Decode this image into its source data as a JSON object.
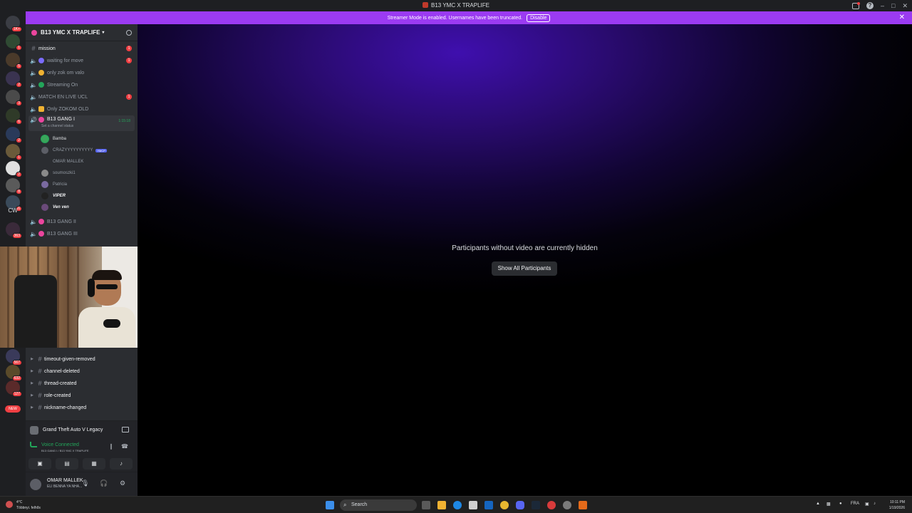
{
  "window": {
    "title": "B13 YMC X TRAPLIFE"
  },
  "banner": {
    "text": "Streamer Mode is enabled. Usernames have been truncated.",
    "disable_label": "Disable"
  },
  "server_rail": {
    "badges": [
      "1K+",
      "1",
      "5",
      "2",
      "3",
      "6",
      "2",
      "1",
      "2",
      "8",
      "6",
      "2",
      "2",
      "363",
      "567",
      "632",
      "127"
    ],
    "cw_label": "CW",
    "new_label": "NEW"
  },
  "guild": {
    "name": "B13 YMC X TRAPLIFE"
  },
  "channels": [
    {
      "name": "mission",
      "type": "text",
      "badge": "1"
    },
    {
      "name": "waiting for move",
      "type": "voice",
      "badge": "1",
      "emoji_color": "#7b6cff"
    },
    {
      "name": "only zok om valo",
      "type": "voice",
      "badge": "",
      "emoji_color": "#f0b232"
    },
    {
      "name": "Streaming On",
      "type": "voice",
      "badge": "",
      "emoji_color": "#23a55a"
    },
    {
      "name": "MATCH EN LIVE UCL",
      "type": "voice",
      "badge": "1",
      "emoji_color": ""
    },
    {
      "name": "Only ZOKOM OLD",
      "type": "voice",
      "badge": "",
      "emoji_color": "#f0b232"
    }
  ],
  "active_channel": {
    "name": "B13 GANG I",
    "timer": "1:15:18",
    "status": "Set a channel status"
  },
  "voice_users": [
    {
      "name": "Bamba",
      "tag": ""
    },
    {
      "name": "CRAZYYYYYYYYYY",
      "tag": "YMCP"
    },
    {
      "name": "OMAR MALLEK",
      "tag": ""
    },
    {
      "name": "soumoszki1",
      "tag": ""
    },
    {
      "name": "Patricia",
      "tag": ""
    },
    {
      "name": "VIPER",
      "tag": ""
    },
    {
      "name": "Ven ven",
      "tag": ""
    }
  ],
  "more_channels": [
    {
      "name": "B13 GANG II"
    },
    {
      "name": "B13 GANG III"
    }
  ],
  "log_channels": [
    "timeout-given-removed",
    "channel-deleted",
    "thread-created",
    "role-created",
    "nickname-changed"
  ],
  "activity": {
    "game": "Grand Theft Auto V Legacy"
  },
  "voice_panel": {
    "status": "Voice Connected",
    "location": "B13 GANG I / B13 YMC X TRAPLIFE"
  },
  "user_panel": {
    "name": "OMAR MALLEK",
    "status": "ELI BENNA YA NHA..."
  },
  "stage": {
    "message": "Participants without video are currently hidden",
    "show_all_label": "Show All Participants"
  },
  "taskbar": {
    "weather_temp": "4°C",
    "weather_desc": "Többnyi. felhős",
    "search_placeholder": "Search",
    "language": "FRA",
    "time": "10:11 PM",
    "date": "1/19/2026"
  },
  "colors": {
    "accent": "#9b3bf2",
    "voice_green": "#23a55a",
    "badge_red": "#f23f43"
  }
}
